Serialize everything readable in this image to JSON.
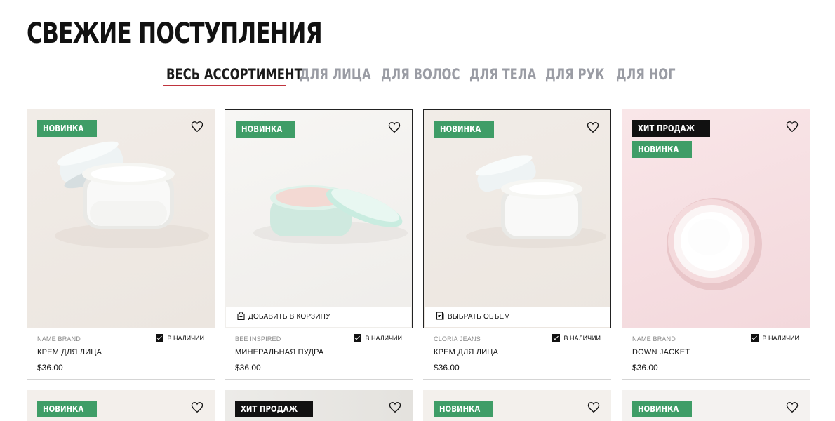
{
  "page_title": "СВЕЖИЕ ПОСТУПЛЕНИЯ",
  "tabs": [
    {
      "label": "ВЕСЬ АССОРТИМЕНТ",
      "active": true
    },
    {
      "label": "ДЛЯ ЛИЦА",
      "active": false
    },
    {
      "label": "ДЛЯ ВОЛОС",
      "active": false
    },
    {
      "label": "ДЛЯ ТЕЛА",
      "active": false
    },
    {
      "label": "ДЛЯ РУК",
      "active": false
    },
    {
      "label": "ДЛЯ НОГ",
      "active": false
    }
  ],
  "badges": {
    "new": "НОВИНКА",
    "hit": "ХИТ ПРОДАЖ"
  },
  "stock_label": "В НАЛИЧИИ",
  "products": [
    {
      "brand": "NAME BRAND",
      "name": "КРЕМ ДЛЯ ЛИЦА",
      "price": "$36.00",
      "badges": [
        "НОВИНКА"
      ],
      "action": ""
    },
    {
      "brand": "BEE INSPIRED",
      "name": "МИНЕРАЛЬНАЯ ПУДРА",
      "price": "$36.00",
      "badges": [
        "НОВИНКА"
      ],
      "action": "ДОБАВИТЬ В КОРЗИНУ"
    },
    {
      "brand": "CLORIA JEANS",
      "name": "КРЕМ ДЛЯ ЛИЦА",
      "price": "$36.00",
      "badges": [
        "НОВИНКА"
      ],
      "action": "ВЫБРАТЬ ОБЪЕМ"
    },
    {
      "brand": "NAME BRAND",
      "name": "DOWN JACKET",
      "price": "$36.00",
      "badges": [
        "ХИТ ПРОДАЖ",
        "НОВИНКА"
      ],
      "action": ""
    }
  ],
  "second_row_badges": [
    "НОВИНКА",
    "ХИТ ПРОДАЖ",
    "НОВИНКА",
    "НОВИНКА"
  ],
  "colors": {
    "accent_underline": "#c0343e",
    "badge_new": "#3f9d67",
    "badge_hit": "#111111",
    "tab_inactive": "#9a9ca4"
  },
  "icons": [
    "heart-icon",
    "bag-icon",
    "size-icon",
    "checkbox-checked-icon"
  ]
}
